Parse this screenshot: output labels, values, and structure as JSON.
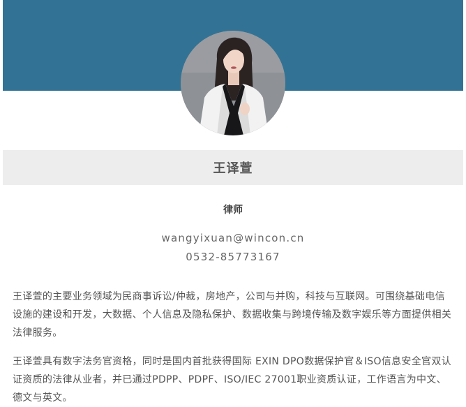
{
  "profile": {
    "name": "王译萱",
    "title": "律师",
    "email": "wangyixuan@wincon.cn",
    "phone": "0532-85773167",
    "photo_icon": "portrait-photo"
  },
  "bio": {
    "paragraph_1": "王译萱的主要业务领域为民商事诉讼/仲裁，房地产，公司与并购，科技与互联网。可围绕基础电信设施的建设和开发，大数据、个人信息及隐私保护、数据收集与跨境传输及数字娱乐等方面提供相关法律服务。",
    "paragraph_2": "王译萱具有数字法务官资格，同时是国内首批获得国际 EXIN DPO数据保护官＆ISO信息安全官双认证资质的法律从业者，并已通过PDPP、PDPF、ISO/IEC 27001职业资质认证，工作语言为中文、德文与英文。"
  },
  "colors": {
    "banner": "#327395",
    "name_bar": "#ededed",
    "text": "#555555"
  }
}
